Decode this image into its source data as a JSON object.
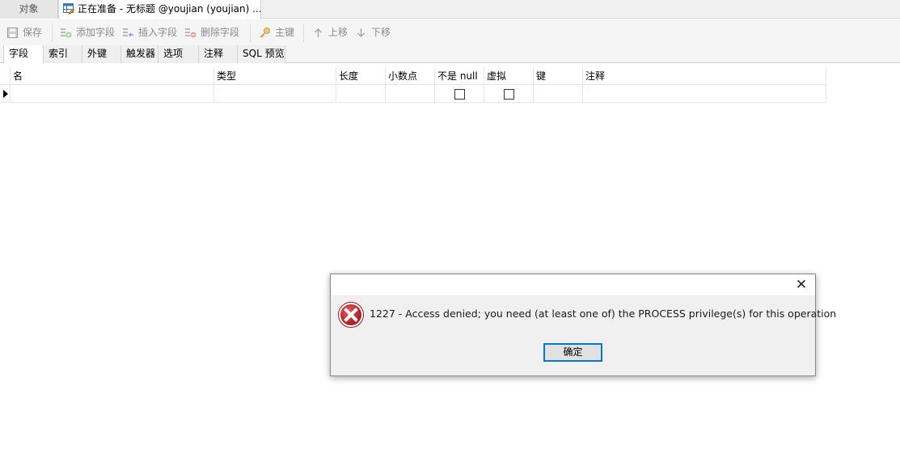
{
  "doc_tabs": {
    "objects_label": "对象",
    "active_label": "正在准备 - 无标题 @youjian (youjian) ..."
  },
  "toolbar": {
    "save_label": "保存",
    "add_field_label": "添加字段",
    "insert_field_label": "插入字段",
    "delete_field_label": "删除字段",
    "primary_key_label": "主键",
    "move_up_label": "上移",
    "move_down_label": "下移"
  },
  "sub_tabs": [
    "字段",
    "索引",
    "外键",
    "触发器",
    "选项",
    "注释",
    "SQL 预览"
  ],
  "grid": {
    "columns": [
      "名",
      "类型",
      "长度",
      "小数点",
      "不是 null",
      "虚拟",
      "键",
      "注释"
    ],
    "rows": [
      {
        "name": "",
        "type": "",
        "length": "",
        "decimals": "",
        "not_null": false,
        "virtual": false,
        "key": "",
        "comment": ""
      }
    ]
  },
  "dialog": {
    "message": "1227 - Access denied; you need (at least one of) the PROCESS privilege(s) for this operation",
    "ok_label": "确定",
    "close_glyph": "✕"
  },
  "colors": {
    "error_red": "#c0272d",
    "focus_blue": "#0078d7"
  }
}
